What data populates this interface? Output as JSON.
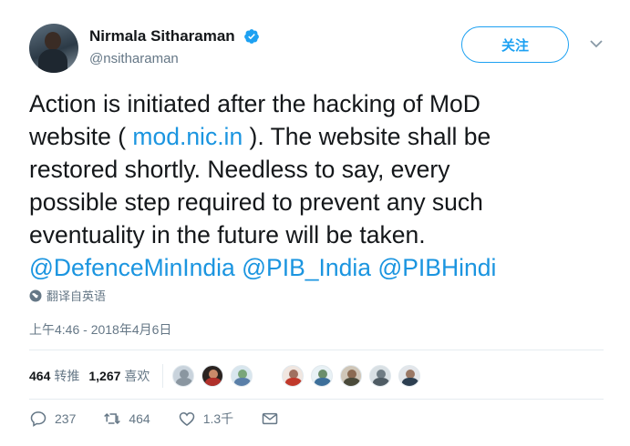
{
  "author": {
    "display_name": "Nirmala Sitharaman",
    "handle": "@nsitharaman",
    "verified_icon": "verified-badge-icon"
  },
  "follow_label": "关注",
  "tweet": {
    "line1": "Action is initiated after the hacking of MoD",
    "line2_before": "website ( ",
    "line2_link": "mod.nic.in",
    "line2_after": " ). The website shall be",
    "line3": "restored shortly. Needless to say, every",
    "line4": "possible step required to prevent any such",
    "line5": "eventuality in the future will be taken.",
    "mention1": "@DefenceMinIndia",
    "mention2": "@PIB_India",
    "mention3": "@PIBHindi"
  },
  "translate_label": "翻译自英语",
  "timestamp": "上午4:46 - 2018年4月6日",
  "stats": {
    "retweets_count": "464",
    "retweets_label": "转推",
    "likes_count": "1,267",
    "likes_label": "喜欢"
  },
  "actions": {
    "replies": "237",
    "retweets": "464",
    "likes": "1.3千"
  },
  "colors": {
    "link": "#1b95e0",
    "accent": "#1da1f2",
    "muted": "#657786"
  }
}
